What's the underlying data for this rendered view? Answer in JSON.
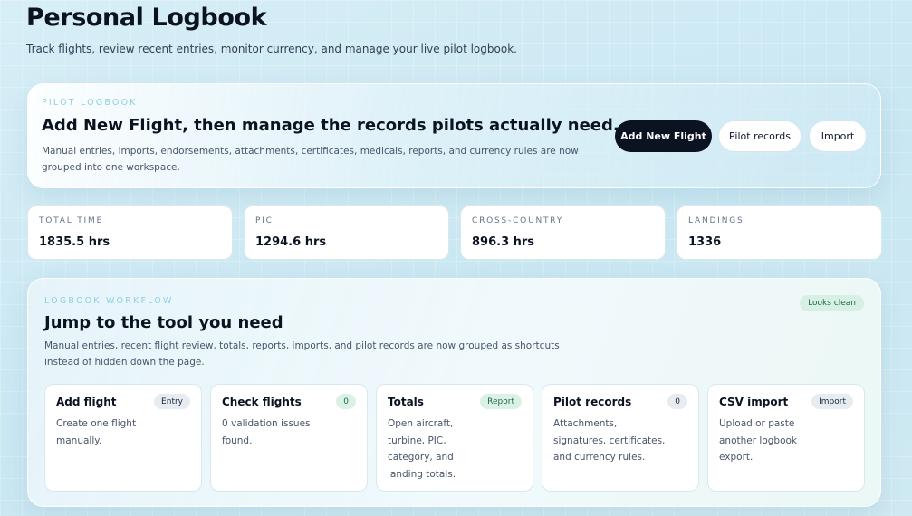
{
  "page": {
    "title": "Personal Logbook",
    "subtitle": "Track flights, review recent entries, monitor currency, and manage your live pilot logbook."
  },
  "hero": {
    "eyebrow": "PILOT LOGBOOK",
    "title": "Add New Flight, then manage the records pilots actually need.",
    "description": "Manual entries, imports, endorsements, attachments, certificates, medicals, reports, and currency rules are now grouped into one workspace.",
    "buttons": {
      "add_flight": "Add New Flight",
      "pilot_records": "Pilot records",
      "import": "Import"
    }
  },
  "stats": [
    {
      "label": "TOTAL TIME",
      "value": "1835.5 hrs"
    },
    {
      "label": "PIC",
      "value": "1294.6 hrs"
    },
    {
      "label": "CROSS-COUNTRY",
      "value": "896.3 hrs"
    },
    {
      "label": "LANDINGS",
      "value": "1336"
    }
  ],
  "workflow": {
    "eyebrow": "LOGBOOK WORKFLOW",
    "status_badge": "Looks clean",
    "title": "Jump to the tool you need",
    "description": "Manual entries, recent flight review, totals, reports, imports, and pilot records are now grouped as shortcuts instead of hidden down the page.",
    "cards": [
      {
        "title": "Add flight",
        "badge": "Entry",
        "description": "Create one flight manually."
      },
      {
        "title": "Check flights",
        "badge": "0",
        "description": "0 validation issues found."
      },
      {
        "title": "Totals",
        "badge": "Report",
        "description": "Open aircraft, turbine, PIC, category, and landing totals."
      },
      {
        "title": "Pilot records",
        "badge": "0",
        "description": "Attachments, signatures, certificates, and currency rules."
      },
      {
        "title": "CSV import",
        "badge": "Import",
        "description": "Upload or paste another logbook export."
      }
    ]
  },
  "colors": {
    "primary": "#0b1220",
    "accent_eyebrow": "#8ecfe3",
    "success_badge_bg": "#d7f0e4",
    "success_badge_text": "#1f6b48"
  }
}
